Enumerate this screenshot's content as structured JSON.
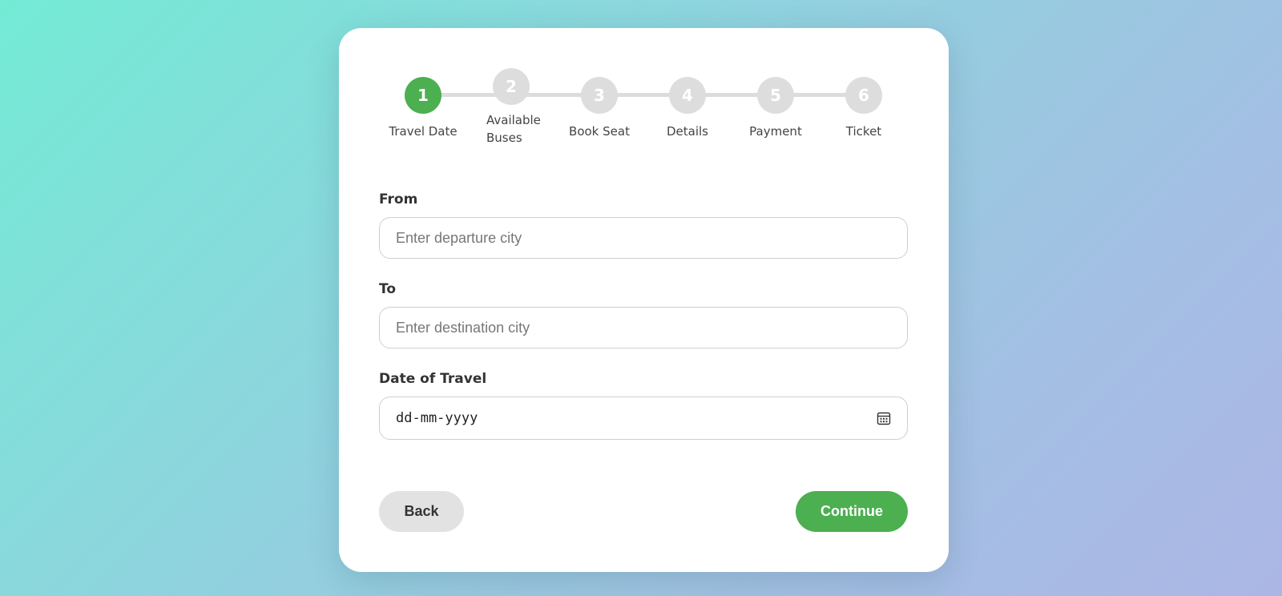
{
  "stepper": {
    "steps": [
      {
        "number": "1",
        "label": "Travel Date",
        "state": "active"
      },
      {
        "number": "2",
        "label": "Available Buses",
        "state": "inactive"
      },
      {
        "number": "3",
        "label": "Book Seat",
        "state": "inactive"
      },
      {
        "number": "4",
        "label": "Details",
        "state": "inactive"
      },
      {
        "number": "5",
        "label": "Payment",
        "state": "inactive"
      },
      {
        "number": "6",
        "label": "Ticket",
        "state": "inactive"
      }
    ],
    "active_color": "#4caf50",
    "inactive_color": "#dddddd"
  },
  "form": {
    "from": {
      "label": "From",
      "placeholder": "Enter departure city",
      "value": ""
    },
    "to": {
      "label": "To",
      "placeholder": "Enter destination city",
      "value": ""
    },
    "date": {
      "label": "Date of Travel",
      "placeholder": "dd-mm-yyyy",
      "icon": "calendar-icon"
    }
  },
  "actions": {
    "back_label": "Back",
    "continue_label": "Continue",
    "primary_color": "#4caf50"
  }
}
